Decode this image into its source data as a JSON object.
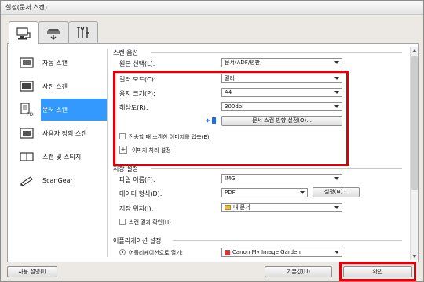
{
  "window": {
    "title": "설정(문서 스캔)"
  },
  "tabs": [
    {
      "icon": "scan-from-computer-icon",
      "active": true
    },
    {
      "icon": "scan-from-operation-panel-icon",
      "active": false
    },
    {
      "icon": "general-settings-icon",
      "active": false
    }
  ],
  "sidebar": {
    "items": [
      {
        "label": "자동 스캔",
        "icon": "auto-scan-icon"
      },
      {
        "label": "사진 스캔",
        "icon": "photo-scan-icon"
      },
      {
        "label": "문서 스캔",
        "icon": "document-scan-icon",
        "selected": true
      },
      {
        "label": "사용자 정의 스캔",
        "icon": "custom-scan-icon"
      },
      {
        "label": "스캔 및 스티치",
        "icon": "scan-and-stitch-icon"
      },
      {
        "label": "ScanGear",
        "icon": "scangear-icon"
      }
    ]
  },
  "scan_options": {
    "title": "스캔 옵션",
    "source_label": "원본 선택(L):",
    "source_value": "문서(ADF/평판)",
    "color_mode_label": "컬러 모드(C):",
    "color_mode_value": "컬러",
    "paper_size_label": "용지 크기(P):",
    "paper_size_value": "A4",
    "resolution_label": "해상도(R):",
    "resolution_value": "300dpi",
    "orientation_button": "문서 스캔 방향 설정(O)...",
    "compress_label": "전송할 때 스캔한 이미지를 압축(E)",
    "image_processing_label": "이미지 처리 설정",
    "expand_symbol": "+"
  },
  "save_settings": {
    "title": "저장 설정",
    "file_name_label": "파일 이름(F):",
    "file_name_value": "IMG",
    "data_format_label": "데이터 형식(D):",
    "data_format_value": "PDF",
    "settings_button": "설정(N)...",
    "save_in_label": "저장 위치(I):",
    "save_in_value": "내 문서",
    "check_result_label": "스캔 결과 확인(H)"
  },
  "app_settings": {
    "title": "어플리케이션 설정",
    "open_with_label": "어플리케이션으로 열기:",
    "open_with_value": "Canon My Image Garden"
  },
  "footer": {
    "help_button": "사용 설명(I)",
    "defaults_button": "기본값(U)",
    "ok_button": "확인"
  },
  "colors": {
    "highlight": "#e0000a",
    "selection": "#3399ff"
  }
}
